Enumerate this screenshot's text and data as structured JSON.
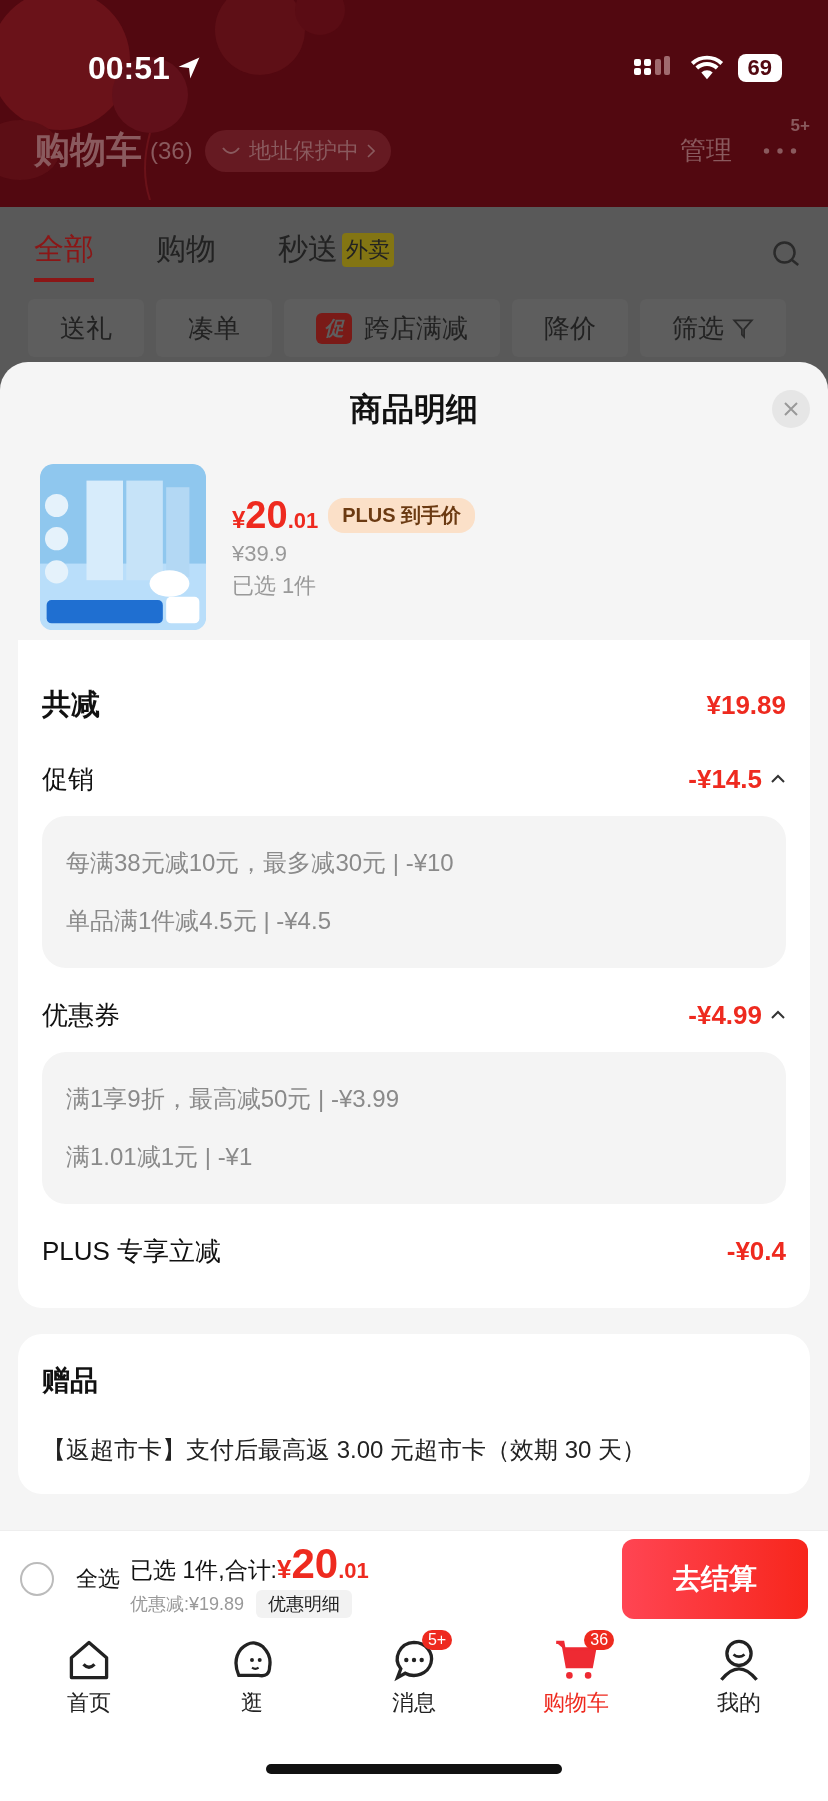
{
  "status_bar": {
    "time": "00:51",
    "battery": "69"
  },
  "header": {
    "title": "购物车",
    "count": "(36)",
    "address_badge": "地址保护中",
    "manage": "管理",
    "more_badge": "5+"
  },
  "tabs": [
    {
      "label": "全部",
      "selected": true
    },
    {
      "label": "购物",
      "selected": false
    },
    {
      "label": "秒送",
      "tag": "外卖",
      "selected": false
    }
  ],
  "filters": [
    {
      "kind": "chip",
      "label": "送礼"
    },
    {
      "kind": "chip",
      "label": "凑单"
    },
    {
      "kind": "promo",
      "tag": "促",
      "label": "跨店满减"
    },
    {
      "kind": "chip",
      "label": "降价"
    },
    {
      "kind": "filter",
      "label": "筛选"
    }
  ],
  "sheet": {
    "title": "商品明细",
    "product": {
      "price_symbol": "¥",
      "price_int": "20",
      "price_dec": ".01",
      "price_tag": "PLUS 到手价",
      "original_price": "¥39.9",
      "selected_count": "已选 1件"
    },
    "rows": [
      {
        "kind": "total",
        "label": "共减",
        "value": "¥19.89"
      },
      {
        "kind": "group",
        "label": "促销",
        "value": "-¥14.5",
        "expanded": true,
        "items": [
          "每满38元减10元，最多减30元 | -¥10",
          "单品满1件减4.5元 | -¥4.5"
        ]
      },
      {
        "kind": "group",
        "label": "优惠券",
        "value": "-¥4.99",
        "expanded": true,
        "items": [
          "满1享9折，最高减50元 | -¥3.99",
          "满1.01减1元 | -¥1"
        ]
      },
      {
        "kind": "plain",
        "label": "PLUS 专享立减",
        "value": "-¥0.4"
      }
    ],
    "gift": {
      "title": "赠品",
      "text": "【返超市卡】支付后最高返 3.00 元超市卡（效期 30 天）"
    }
  },
  "checkout": {
    "select_all": {
      "label": "全选",
      "checked": false
    },
    "summary": "已选 1件,合计:",
    "total_symbol": "¥",
    "total_int": "20",
    "total_dec": ".01",
    "discount": "优惠减:¥19.89",
    "detail_button": "优惠明细",
    "checkout_button": "去结算"
  },
  "tab_bar": [
    {
      "label": "首页",
      "selected": false
    },
    {
      "label": "逛",
      "selected": false
    },
    {
      "label": "消息",
      "selected": false,
      "badge": "5+"
    },
    {
      "label": "购物车",
      "selected": true,
      "badge": "36"
    },
    {
      "label": "我的",
      "selected": false
    }
  ]
}
